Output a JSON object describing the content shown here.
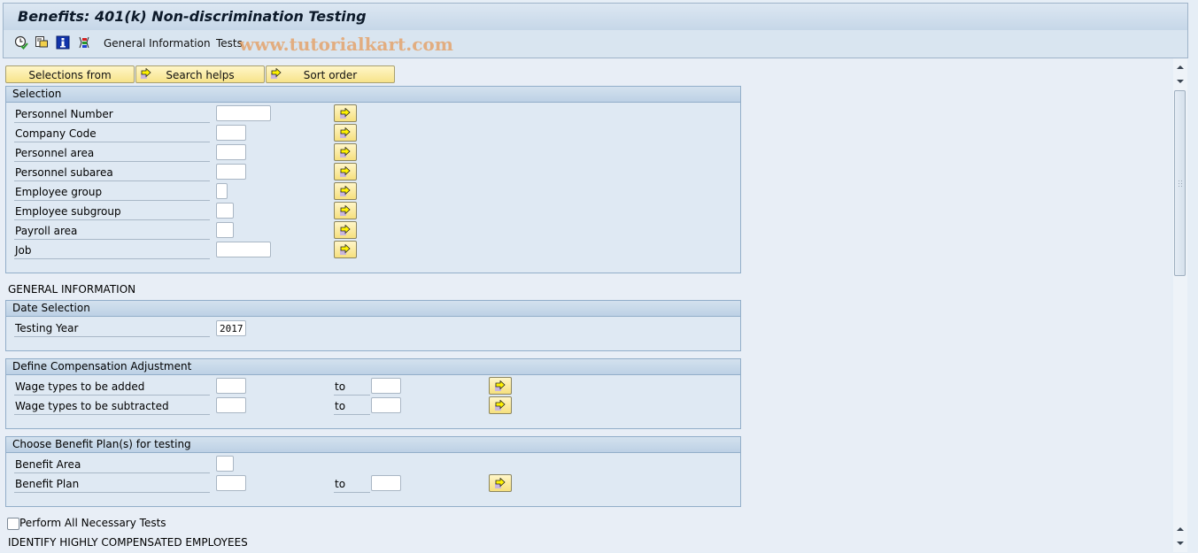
{
  "window": {
    "title": "Benefits: 401(k) Non-discrimination Testing"
  },
  "toolbar": {
    "icons": [
      "execute-icon",
      "variants-icon",
      "info-icon",
      "selection-options-icon"
    ],
    "menu_items": [
      "General Information",
      "Tests"
    ],
    "watermark": "www.tutorialkart.com"
  },
  "top_buttons": [
    {
      "label": "Selections from",
      "icon": "none"
    },
    {
      "label": "Search helps",
      "icon": "arrow-right-icon"
    },
    {
      "label": "Sort order",
      "icon": "arrow-right-icon"
    }
  ],
  "selection": {
    "header": "Selection",
    "rows": [
      {
        "label": "Personnel Number",
        "value": ""
      },
      {
        "label": "Company Code",
        "value": ""
      },
      {
        "label": "Personnel area",
        "value": ""
      },
      {
        "label": "Personnel subarea",
        "value": ""
      },
      {
        "label": "Employee group",
        "value": ""
      },
      {
        "label": "Employee subgroup",
        "value": ""
      },
      {
        "label": "Payroll area",
        "value": ""
      },
      {
        "label": "Job",
        "value": ""
      }
    ]
  },
  "general_information": {
    "heading": "GENERAL INFORMATION",
    "date_selection": {
      "header": "Date Selection",
      "testing_year_label": "Testing Year",
      "testing_year_value": "2017"
    },
    "compensation_adjustment": {
      "header": "Define Compensation Adjustment",
      "to_label": "to",
      "rows": [
        {
          "label": "Wage types to be added",
          "from": "",
          "to": ""
        },
        {
          "label": "Wage types to be subtracted",
          "from": "",
          "to": ""
        }
      ]
    },
    "benefit_plans": {
      "header": "Choose Benefit Plan(s) for testing",
      "benefit_area_label": "Benefit Area",
      "benefit_area_value": "",
      "benefit_plan_label": "Benefit Plan",
      "benefit_plan_from": "",
      "benefit_plan_to": "",
      "to_label": "to"
    }
  },
  "tests": {
    "perform_all_label": "Perform All Necessary Tests",
    "perform_all_checked": false,
    "hce_heading": "IDENTIFY HIGHLY COMPENSATED EMPLOYEES"
  },
  "colors": {
    "button_yellow": "#f7e38a",
    "group_header": "#bdd1e5",
    "background": "#e8eef6"
  }
}
